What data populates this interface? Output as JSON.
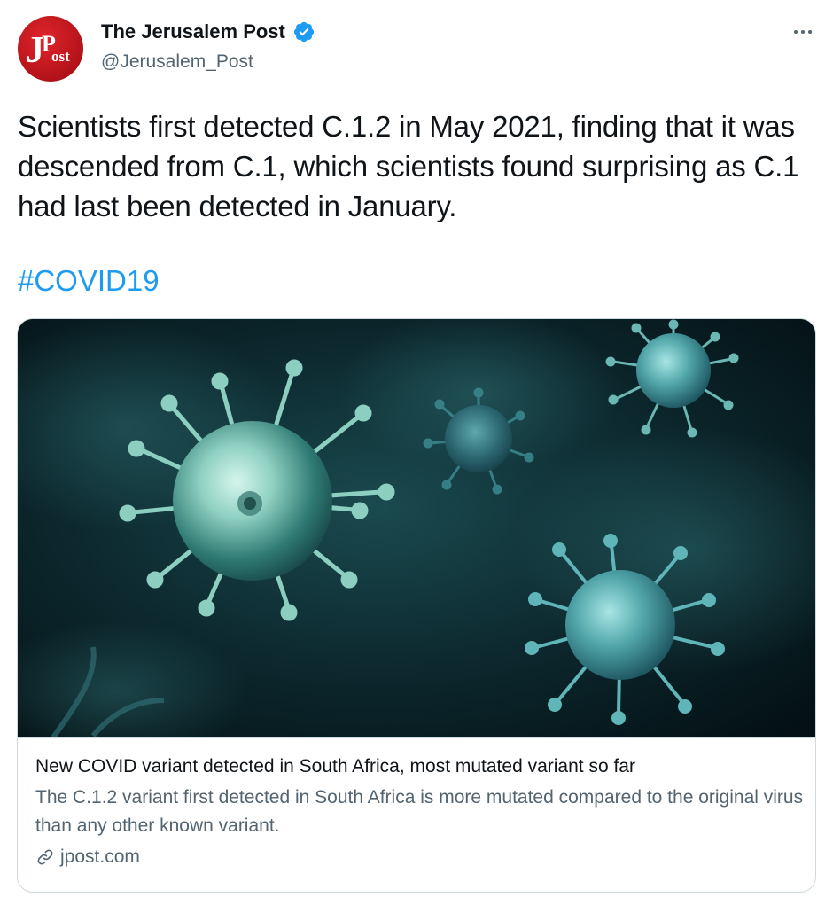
{
  "author": {
    "display_name": "The Jerusalem Post",
    "handle": "@Jerusalem_Post",
    "verified": true,
    "avatar_icon": "jpost-logo",
    "avatar_logo_text": "JPost"
  },
  "tweet": {
    "text": "Scientists first detected C.1.2 in May 2021, finding that it was descended from C.1, which scientists found surprising as C.1 had last been detected in January.",
    "hashtag": "#COVID19"
  },
  "card": {
    "image_icon": "virus-illustration",
    "title": "New COVID variant detected in South Africa, most mutated variant so far",
    "description": "The C.1.2 variant first detected in South Africa is more mutated compared to the original virus than any other known variant.",
    "domain": "jpost.com"
  },
  "colors": {
    "accent": "#1d9bf0",
    "text_primary": "#0f1419",
    "text_secondary": "#536471",
    "border": "#cfd9de",
    "avatar_red": "#c8161d"
  }
}
